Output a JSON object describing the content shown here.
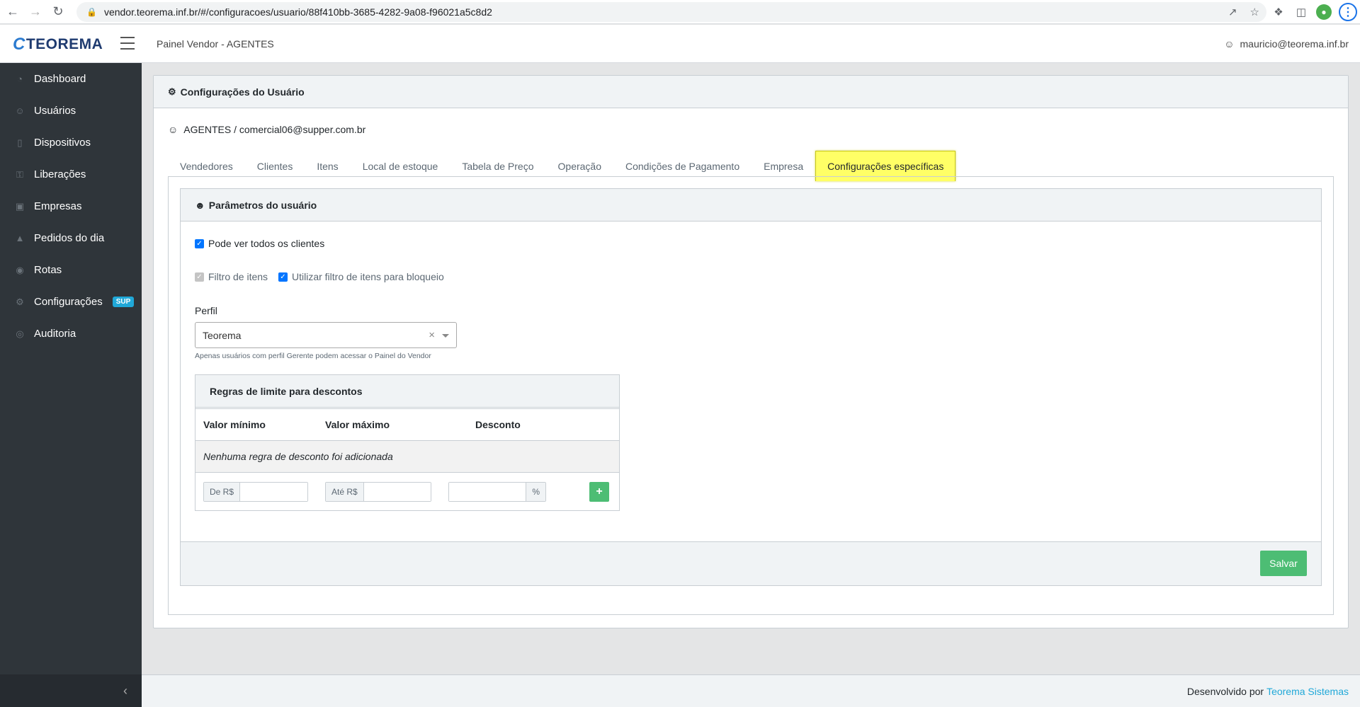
{
  "browser": {
    "url": "vendor.teorema.inf.br/#/configuracoes/usuario/88f410bb-3685-4282-9a08-f96021a5c8d2",
    "back_icon": "arrow-left-icon",
    "forward_icon": "arrow-right-icon",
    "reload_icon": "reload-icon"
  },
  "header": {
    "logo": "TEOREMA",
    "app_title": "Painel Vendor - AGENTES",
    "user_email": "mauricio@teorema.inf.br"
  },
  "sidebar": {
    "items": [
      {
        "label": "Dashboard",
        "icon": "speedometer-icon"
      },
      {
        "label": "Usuários",
        "icon": "users-icon"
      },
      {
        "label": "Dispositivos",
        "icon": "phone-icon"
      },
      {
        "label": "Liberações",
        "icon": "key-icon"
      },
      {
        "label": "Empresas",
        "icon": "briefcase-icon"
      },
      {
        "label": "Pedidos do dia",
        "icon": "basket-icon"
      },
      {
        "label": "Rotas",
        "icon": "location-icon"
      },
      {
        "label": "Configurações",
        "icon": "gear-icon",
        "badge": "SUP"
      },
      {
        "label": "Auditoria",
        "icon": "eye-icon"
      }
    ]
  },
  "page": {
    "title": "Configurações do Usuário",
    "user_line": "AGENTES / comercial06@supper.com.br",
    "tabs": [
      {
        "label": "Vendedores",
        "active": false
      },
      {
        "label": "Clientes",
        "active": false
      },
      {
        "label": "Itens",
        "active": false
      },
      {
        "label": "Local de estoque",
        "active": false
      },
      {
        "label": "Tabela de Preço",
        "active": false
      },
      {
        "label": "Operação",
        "active": false
      },
      {
        "label": "Condições de Pagamento",
        "active": false
      },
      {
        "label": "Empresa",
        "active": false
      },
      {
        "label": "Configurações específicas",
        "active": true
      }
    ]
  },
  "params": {
    "title": "Parâmetros do usuário",
    "see_all_clients": {
      "label": "Pode ver todos os clientes",
      "checked": true
    },
    "item_filter": {
      "label": "Filtro de itens",
      "checked": true,
      "disabled": true
    },
    "use_item_filter_block": {
      "label": "Utilizar filtro de itens para bloqueio",
      "checked": true
    },
    "perfil_label": "Perfil",
    "perfil_value": "Teorema",
    "perfil_help": "Apenas usuários com perfil Gerente podem acessar o Painel do Vendor"
  },
  "discount_rules": {
    "title": "Regras de limite para descontos",
    "columns": [
      "Valor mínimo",
      "Valor máximo",
      "Desconto"
    ],
    "empty_message": "Nenhuma regra de desconto foi adicionada",
    "min_prefix": "De R$",
    "max_prefix": "Até R$",
    "discount_suffix": "%",
    "min_value": "",
    "max_value": "",
    "discount_value": "",
    "add_label": "+"
  },
  "actions": {
    "save_label": "Salvar"
  },
  "footer": {
    "text": "Desenvolvido por",
    "link": "Teorema Sistemas"
  },
  "colors": {
    "sidebar_bg": "#2f353a",
    "active_tab_highlight": "#ffff66",
    "success": "#4dbd74",
    "link": "#20a8d8"
  }
}
